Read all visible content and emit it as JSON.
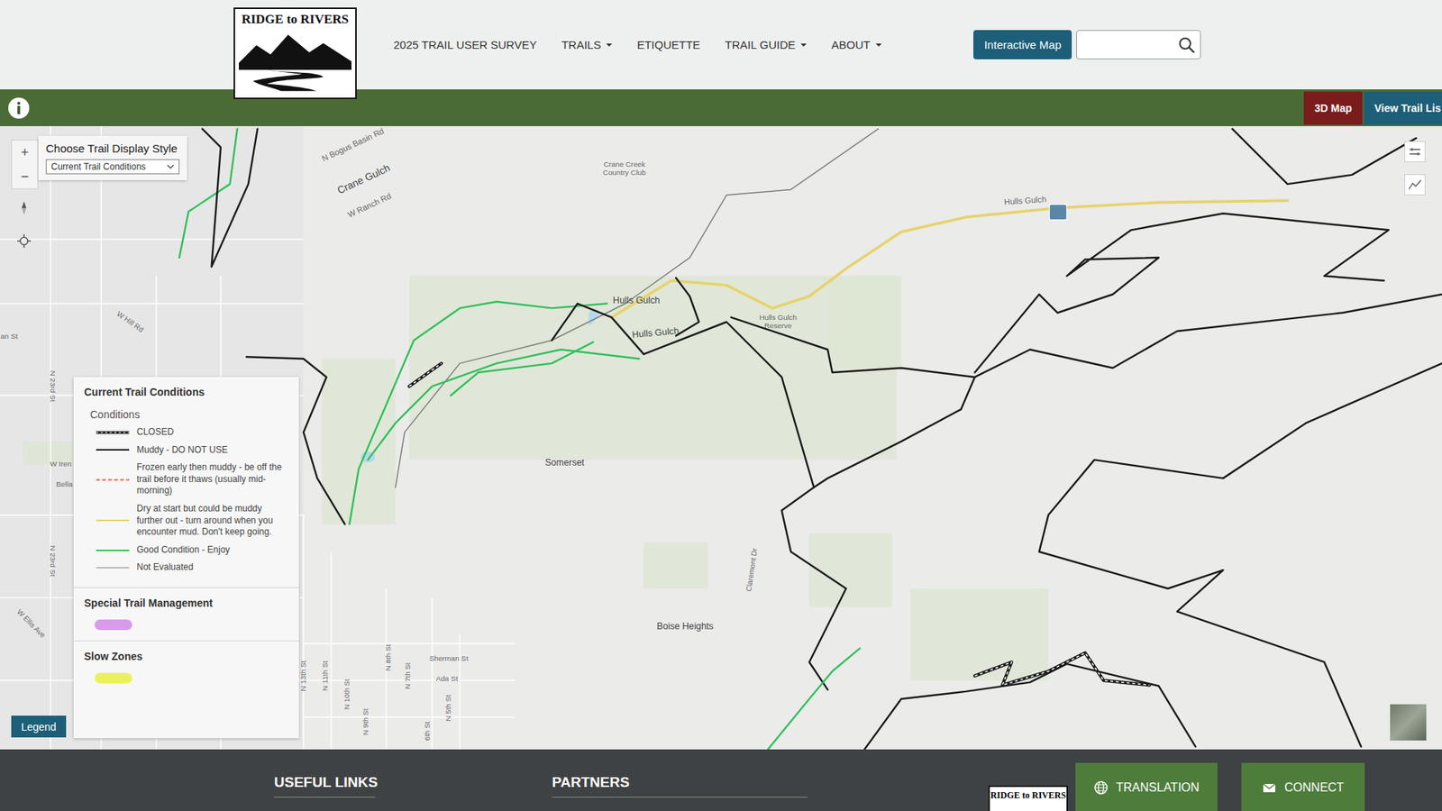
{
  "header": {
    "logo": "RIDGE to RIVERS",
    "nav": [
      {
        "label": "2025 TRAIL USER SURVEY",
        "dropdown": false
      },
      {
        "label": "TRAILS",
        "dropdown": true
      },
      {
        "label": "ETIQUETTE",
        "dropdown": false
      },
      {
        "label": "TRAIL GUIDE",
        "dropdown": true
      },
      {
        "label": "ABOUT",
        "dropdown": true
      }
    ],
    "map_button": "Interactive Map",
    "search": {
      "placeholder": ""
    }
  },
  "toolbar": {
    "buttons": [
      {
        "label": "3D Map",
        "color": "#7b1c1c"
      },
      {
        "label": "View Trail Lis",
        "color": "#1d5e78"
      }
    ]
  },
  "map": {
    "zoom": [
      "+",
      "−"
    ],
    "display_style": {
      "label": "Choose Trail Display Style",
      "value": "Current Trail Conditions"
    },
    "labels": [
      {
        "text": "N Bogus Basin Rd",
        "kind": "road"
      },
      {
        "text": "Crane Gulch",
        "kind": "place"
      },
      {
        "text": "W Ranch Rd",
        "kind": "road"
      },
      {
        "text": "Crane Creek",
        "kind": "road"
      },
      {
        "text": "Country Club",
        "kind": "road"
      },
      {
        "text": "Hulls Gulch",
        "kind": "road"
      },
      {
        "text": "Hulls Gulch",
        "kind": "place"
      },
      {
        "text": "Hulls Gulch",
        "kind": "place"
      },
      {
        "text": "Hulls Gulch",
        "kind": "road"
      },
      {
        "text": "Reserve",
        "kind": "road"
      },
      {
        "text": "Somerset",
        "kind": "place"
      },
      {
        "text": "Boise Heights",
        "kind": "place"
      },
      {
        "text": "W Hill Rd",
        "kind": "road"
      },
      {
        "text": "N 23rd St",
        "kind": "road"
      },
      {
        "text": "N 23rd St",
        "kind": "road"
      },
      {
        "text": "Claremont Dr",
        "kind": "road"
      },
      {
        "text": "Sherman St",
        "kind": "road"
      },
      {
        "text": "Ada St",
        "kind": "road"
      },
      {
        "text": "N 13th St",
        "kind": "road"
      },
      {
        "text": "N 11th St",
        "kind": "road"
      },
      {
        "text": "N 10th St",
        "kind": "road"
      },
      {
        "text": "N 8th St",
        "kind": "road"
      },
      {
        "text": "N 7th St",
        "kind": "road"
      },
      {
        "text": "N 9th St",
        "kind": "road"
      },
      {
        "text": "6th St",
        "kind": "road"
      },
      {
        "text": "N 5th St",
        "kind": "road"
      },
      {
        "text": "an St",
        "kind": "road"
      },
      {
        "text": "W Iren",
        "kind": "road"
      },
      {
        "text": "Bella",
        "kind": "road"
      },
      {
        "text": "W Ellis Ave",
        "kind": "road"
      }
    ],
    "trails": [
      {
        "kind": "wide",
        "color": "#e6d36c"
      },
      {
        "kind": "thin",
        "color": "#7a7a7a"
      },
      {
        "kind": "solid",
        "color": "#2fbf5a"
      },
      {
        "kind": "solid",
        "color": "#2fbf5a"
      },
      {
        "kind": "solid",
        "color": "#2fbf5a"
      },
      {
        "kind": "solid",
        "color": "#2fbf5a"
      },
      {
        "kind": "solid",
        "color": "#1a1a1a"
      },
      {
        "kind": "solid",
        "color": "#1a1a1a"
      },
      {
        "kind": "solid",
        "color": "#1a1a1a"
      },
      {
        "kind": "solid",
        "color": "#1a1a1a"
      },
      {
        "kind": "solid",
        "color": "#1a1a1a"
      },
      {
        "kind": "solid",
        "color": "#1a1a1a"
      },
      {
        "kind": "solid",
        "color": "#1a1a1a"
      },
      {
        "kind": "solid",
        "color": "#1a1a1a"
      },
      {
        "kind": "solid",
        "color": "#1a1a1a"
      },
      {
        "kind": "solid",
        "color": "#1a1a1a"
      },
      {
        "kind": "solid",
        "color": "#1a1a1a"
      },
      {
        "kind": "solid",
        "color": "#1a1a1a"
      },
      {
        "kind": "closed",
        "color": "#1a1a1a"
      },
      {
        "kind": "closed",
        "color": "#1a1a1a"
      },
      {
        "kind": "solid",
        "color": "#2fbf5a"
      },
      {
        "kind": "solid",
        "color": "#1a1a1a"
      }
    ],
    "legend_button": "Legend"
  },
  "legend": {
    "title": "Current Trail Conditions",
    "subtitle": "Conditions",
    "conditions": [
      {
        "label": "CLOSED",
        "kind": "closed",
        "color": "#1a1a1a"
      },
      {
        "label": "Muddy - DO NOT USE",
        "kind": "solid",
        "color": "#1a1a1a"
      },
      {
        "label": "Frozen early then muddy - be off the trail before it thaws (usually mid-morning)",
        "kind": "dashed",
        "color": "#e8866a"
      },
      {
        "label": "Dry at start but could be muddy further out - turn around when you encounter mud. Don't keep going.",
        "kind": "solid",
        "color": "#e6d36c"
      },
      {
        "label": "Good Condition - Enjoy",
        "kind": "solid",
        "color": "#2fbf5a"
      },
      {
        "label": "Not Evaluated",
        "kind": "thin",
        "color": "#7a7a7a"
      }
    ],
    "sections": [
      {
        "title": "Special Trail Management",
        "color": "#d99be9"
      },
      {
        "title": "Slow Zones",
        "color": "#e9f25e"
      }
    ]
  },
  "footer": {
    "headings": [
      "USEFUL LINKS",
      "PARTNERS"
    ],
    "logo": "RIDGE to RIVERS",
    "buttons": [
      "TRANSLATION",
      "CONNECT"
    ]
  }
}
